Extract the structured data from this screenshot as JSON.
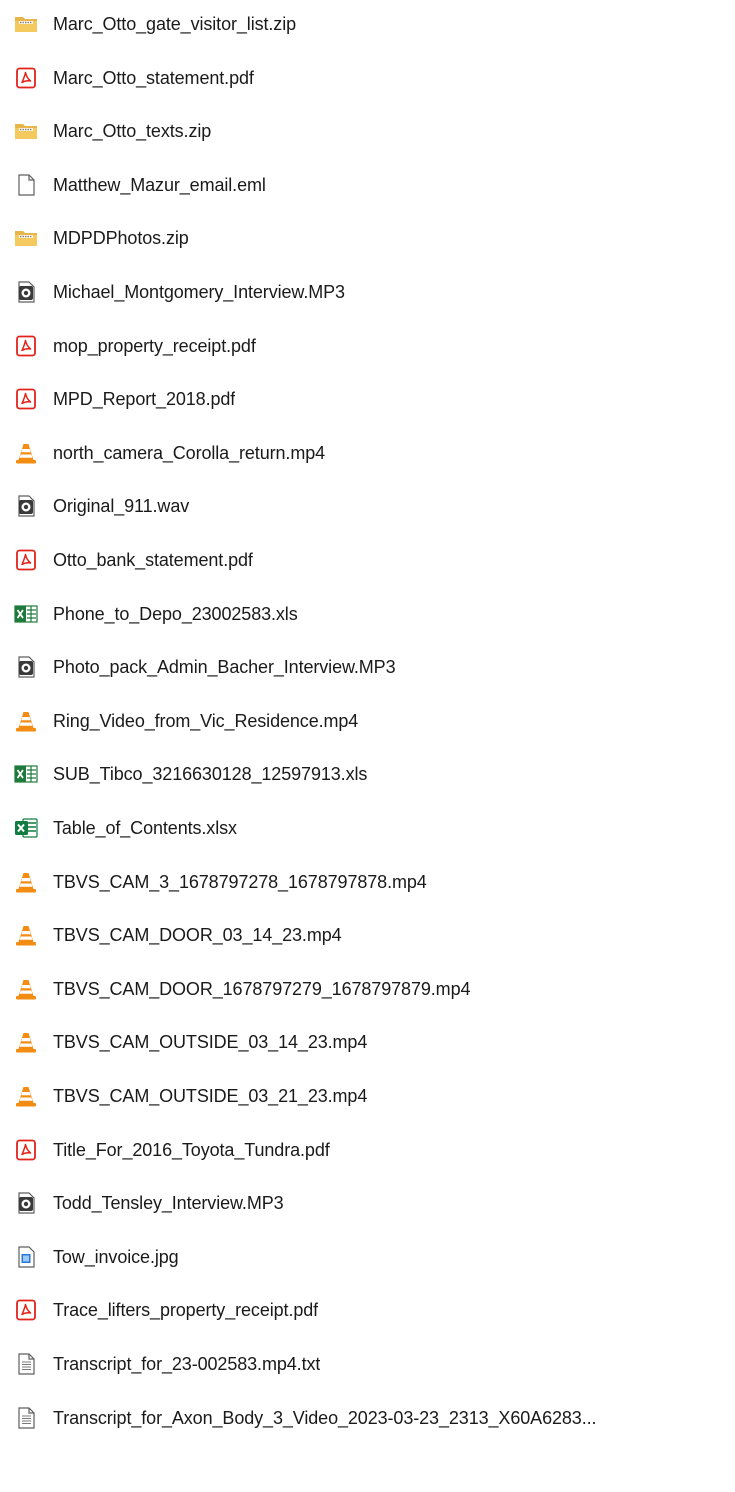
{
  "files": [
    {
      "name": "Marc_Otto_gate_visitor_list.zip",
      "icon": "zip-folder-icon"
    },
    {
      "name": "Marc_Otto_statement.pdf",
      "icon": "pdf-icon"
    },
    {
      "name": "Marc_Otto_texts.zip",
      "icon": "zip-folder-icon"
    },
    {
      "name": "Matthew_Mazur_email.eml",
      "icon": "blank-file-icon"
    },
    {
      "name": "MDPDPhotos.zip",
      "icon": "zip-folder-icon"
    },
    {
      "name": "Michael_Montgomery_Interview.MP3",
      "icon": "audio-file-icon"
    },
    {
      "name": "mop_property_receipt.pdf",
      "icon": "pdf-icon"
    },
    {
      "name": "MPD_Report_2018.pdf",
      "icon": "pdf-icon"
    },
    {
      "name": "north_camera_Corolla_return.mp4",
      "icon": "vlc-cone-icon"
    },
    {
      "name": "Original_911.wav",
      "icon": "audio-file-icon"
    },
    {
      "name": "Otto_bank_statement.pdf",
      "icon": "pdf-icon"
    },
    {
      "name": "Phone_to_Depo_23002583.xls",
      "icon": "excel-legacy-icon"
    },
    {
      "name": "Photo_pack_Admin_Bacher_Interview.MP3",
      "icon": "audio-file-icon"
    },
    {
      "name": "Ring_Video_from_Vic_Residence.mp4",
      "icon": "vlc-cone-icon"
    },
    {
      "name": "SUB_Tibco_3216630128_12597913.xls",
      "icon": "excel-legacy-icon"
    },
    {
      "name": "Table_of_Contents.xlsx",
      "icon": "excel-icon"
    },
    {
      "name": "TBVS_CAM_3_1678797278_1678797878.mp4",
      "icon": "vlc-cone-icon"
    },
    {
      "name": "TBVS_CAM_DOOR_03_14_23.mp4",
      "icon": "vlc-cone-icon"
    },
    {
      "name": "TBVS_CAM_DOOR_1678797279_1678797879.mp4",
      "icon": "vlc-cone-icon"
    },
    {
      "name": "TBVS_CAM_OUTSIDE_03_14_23.mp4",
      "icon": "vlc-cone-icon"
    },
    {
      "name": "TBVS_CAM_OUTSIDE_03_21_23.mp4",
      "icon": "vlc-cone-icon"
    },
    {
      "name": "Title_For_2016_Toyota_Tundra.pdf",
      "icon": "pdf-icon"
    },
    {
      "name": "Todd_Tensley_Interview.MP3",
      "icon": "audio-file-icon"
    },
    {
      "name": "Tow_invoice.jpg",
      "icon": "image-file-icon"
    },
    {
      "name": "Trace_lifters_property_receipt.pdf",
      "icon": "pdf-icon"
    },
    {
      "name": "Transcript_for_23-002583.mp4.txt",
      "icon": "text-file-icon"
    },
    {
      "name": "Transcript_for_Axon_Body_3_Video_2023-03-23_2313_X60A6283...",
      "icon": "text-file-icon"
    }
  ]
}
